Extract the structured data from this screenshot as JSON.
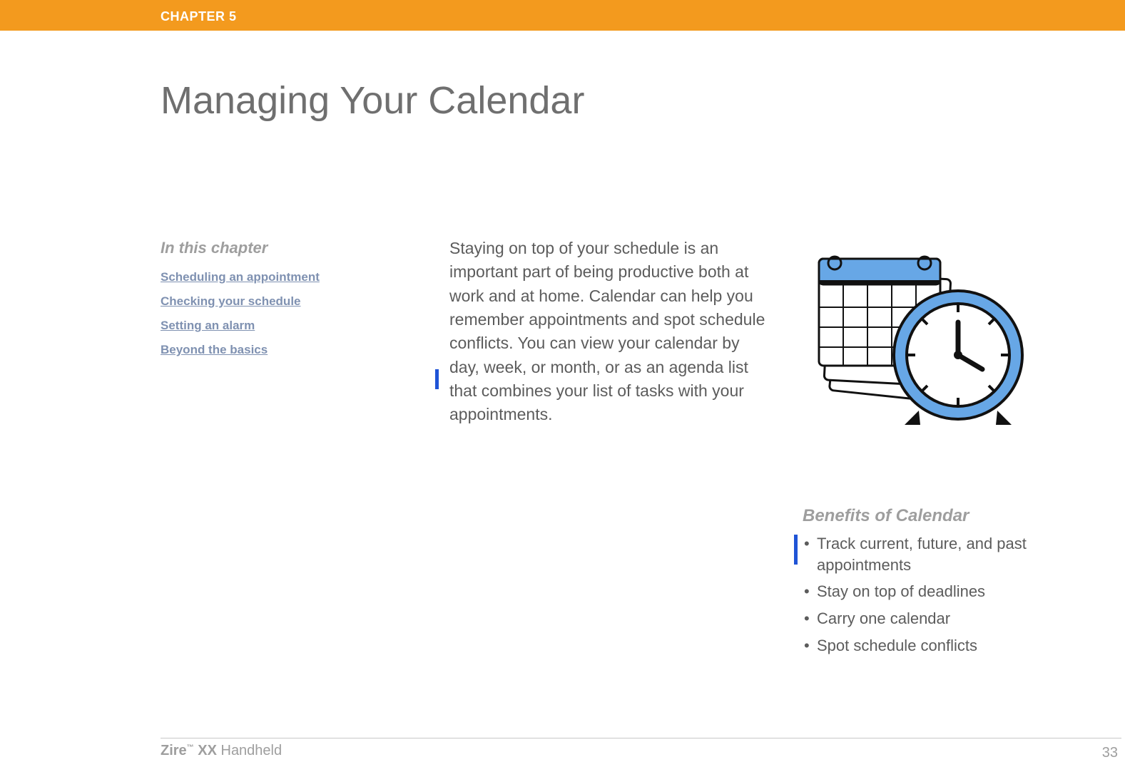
{
  "chapter_label": "CHAPTER 5",
  "title": "Managing Your Calendar",
  "sidebar": {
    "heading": "In this chapter",
    "links": [
      "Scheduling an appointment",
      "Checking your schedule",
      "Setting an alarm",
      "Beyond the basics"
    ]
  },
  "intro": "Staying on top of your schedule is an important part of being productive both at work and at home. Calendar can help you remember appointments and spot schedule conflicts. You can view your calendar by day, week, or month, or as an agenda list that combines your list of tasks with your appointments.",
  "benefits": {
    "heading": "Benefits of Calendar",
    "items": [
      "Track current, future, and past appointments",
      "Stay on top of deadlines",
      "Carry one calendar",
      "Spot schedule conflicts"
    ]
  },
  "footer": {
    "brand": "Zire",
    "tm": "™",
    "model": " XX",
    "suffix": " Handheld",
    "page": "33"
  }
}
